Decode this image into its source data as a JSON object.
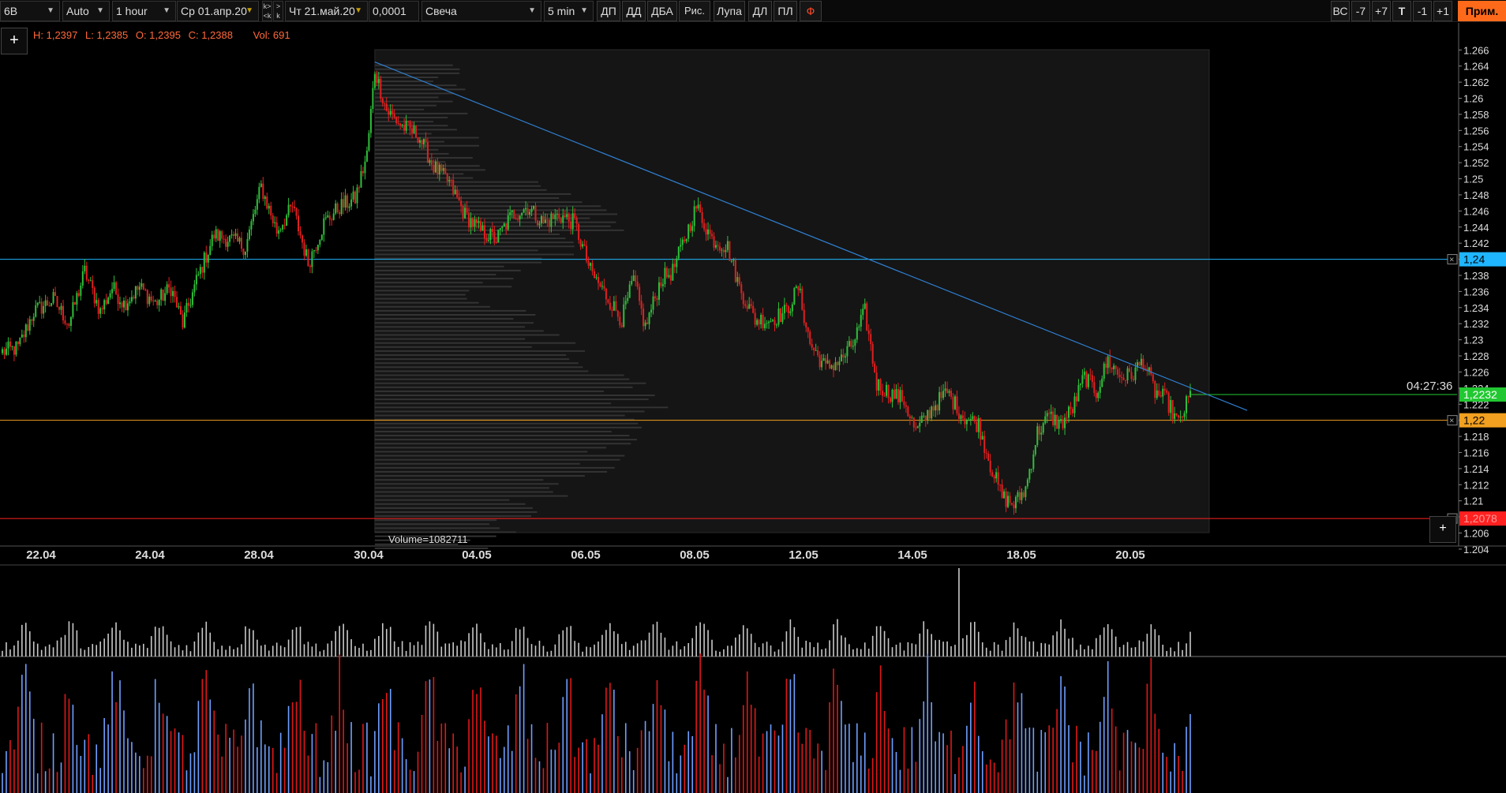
{
  "toolbar": {
    "symbol": "6B",
    "scale_mode": "Auto",
    "timeframe": "1 hour",
    "date_from": "Ср 01.апр.20",
    "date_to": "Чт 21.май.20",
    "tick_size": "0,0001",
    "chart_style": "Свеча",
    "profile_period": "5 min",
    "btn_dp": "ДП",
    "btn_dd": "ДД",
    "btn_dba": "ДБА",
    "btn_draw": "Рис.",
    "btn_zoom": "Лупа",
    "btn_dl": "ДЛ",
    "btn_pl": "ПЛ",
    "btn_phi": "Ф",
    "btn_vs": "ВС",
    "btn_minus7": "-7",
    "btn_plus7": "+7",
    "btn_t": "T",
    "btn_minus1": "-1",
    "btn_plus1": "+1",
    "btn_apply": "Прим."
  },
  "ohlc": {
    "high": "H: 1,2397",
    "low": "L: 1,2385",
    "open": "O: 1,2395",
    "close": "C: 1,2388",
    "volume": "Vol: 691"
  },
  "volume_profile_label": "Volume=1082711",
  "timer": "04:27:36",
  "price_labels": {
    "line_blue": "1,24",
    "last": "1,2232",
    "line_orange": "1,22",
    "line_red": "1,2078"
  },
  "colors": {
    "up": "#2fbf3a",
    "down": "#e02020",
    "blue_line": "#1fb6ff",
    "orange_line": "#f2a020",
    "red_line": "#ff2020",
    "trend": "#2f7fd0",
    "last_price": "#22c832",
    "vol_red": "#e01818",
    "vol_blue": "#6f9fff",
    "apply_button": "#ff6a1a"
  },
  "chart_data": {
    "type": "candlestick",
    "yticks": [
      "1.266",
      "1.264",
      "1.262",
      "1.26",
      "1.258",
      "1.256",
      "1.254",
      "1.252",
      "1.25",
      "1.248",
      "1.246",
      "1.244",
      "1.242",
      "1.24",
      "1.238",
      "1.236",
      "1.234",
      "1.232",
      "1.23",
      "1.228",
      "1.226",
      "1.224",
      "1.222",
      "1.22",
      "1.218",
      "1.216",
      "1.214",
      "1.212",
      "1.21",
      "1.208",
      "1.206",
      "1.204"
    ],
    "xticks": [
      "22.04",
      "24.04",
      "28.04",
      "30.04",
      "04.05",
      "06.05",
      "08.05",
      "12.05",
      "14.05",
      "18.05",
      "20.05"
    ],
    "ylim": [
      1.2036,
      1.2675
    ],
    "horizontal_lines": [
      {
        "price": 1.24,
        "color": "blue_line"
      },
      {
        "price": 1.22,
        "color": "orange_line"
      },
      {
        "price": 1.2078,
        "color": "red_line"
      }
    ],
    "last_price": 1.2232,
    "trendline": {
      "from": {
        "date": "30.04",
        "price": 1.2645
      },
      "to": {
        "date": "21.05",
        "price": 1.2178
      }
    },
    "waypoints": [
      {
        "i": 0,
        "p": 1.2285
      },
      {
        "i": 8,
        "p": 1.229
      },
      {
        "i": 16,
        "p": 1.2335
      },
      {
        "i": 26,
        "p": 1.235
      },
      {
        "i": 34,
        "p": 1.232
      },
      {
        "i": 42,
        "p": 1.2385
      },
      {
        "i": 50,
        "p": 1.2335
      },
      {
        "i": 56,
        "p": 1.2365
      },
      {
        "i": 62,
        "p": 1.2345
      },
      {
        "i": 70,
        "p": 1.2365
      },
      {
        "i": 78,
        "p": 1.2345
      },
      {
        "i": 86,
        "p": 1.2365
      },
      {
        "i": 92,
        "p": 1.232
      },
      {
        "i": 100,
        "p": 1.238
      },
      {
        "i": 108,
        "p": 1.243
      },
      {
        "i": 116,
        "p": 1.2425
      },
      {
        "i": 124,
        "p": 1.2415
      },
      {
        "i": 132,
        "p": 1.249
      },
      {
        "i": 140,
        "p": 1.2435
      },
      {
        "i": 148,
        "p": 1.2465
      },
      {
        "i": 156,
        "p": 1.2395
      },
      {
        "i": 164,
        "p": 1.2445
      },
      {
        "i": 172,
        "p": 1.2465
      },
      {
        "i": 180,
        "p": 1.2475
      },
      {
        "i": 186,
        "p": 1.253
      },
      {
        "i": 190,
        "p": 1.2635
      },
      {
        "i": 196,
        "p": 1.2585
      },
      {
        "i": 204,
        "p": 1.2565
      },
      {
        "i": 212,
        "p": 1.2555
      },
      {
        "i": 220,
        "p": 1.2515
      },
      {
        "i": 228,
        "p": 1.2495
      },
      {
        "i": 236,
        "p": 1.2455
      },
      {
        "i": 244,
        "p": 1.2435
      },
      {
        "i": 252,
        "p": 1.2425
      },
      {
        "i": 260,
        "p": 1.2455
      },
      {
        "i": 268,
        "p": 1.2465
      },
      {
        "i": 276,
        "p": 1.2445
      },
      {
        "i": 284,
        "p": 1.2455
      },
      {
        "i": 292,
        "p": 1.2445
      },
      {
        "i": 300,
        "p": 1.2385
      },
      {
        "i": 308,
        "p": 1.2355
      },
      {
        "i": 316,
        "p": 1.2325
      },
      {
        "i": 322,
        "p": 1.2375
      },
      {
        "i": 328,
        "p": 1.2315
      },
      {
        "i": 336,
        "p": 1.2375
      },
      {
        "i": 342,
        "p": 1.2385
      },
      {
        "i": 348,
        "p": 1.2425
      },
      {
        "i": 354,
        "p": 1.2465
      },
      {
        "i": 362,
        "p": 1.2425
      },
      {
        "i": 370,
        "p": 1.2415
      },
      {
        "i": 376,
        "p": 1.2365
      },
      {
        "i": 384,
        "p": 1.2325
      },
      {
        "i": 392,
        "p": 1.2325
      },
      {
        "i": 400,
        "p": 1.2335
      },
      {
        "i": 406,
        "p": 1.2365
      },
      {
        "i": 412,
        "p": 1.2295
      },
      {
        "i": 420,
        "p": 1.2265
      },
      {
        "i": 428,
        "p": 1.2275
      },
      {
        "i": 434,
        "p": 1.2295
      },
      {
        "i": 440,
        "p": 1.2335
      },
      {
        "i": 446,
        "p": 1.2245
      },
      {
        "i": 452,
        "p": 1.2235
      },
      {
        "i": 460,
        "p": 1.2225
      },
      {
        "i": 466,
        "p": 1.2185
      },
      {
        "i": 474,
        "p": 1.2215
      },
      {
        "i": 482,
        "p": 1.2235
      },
      {
        "i": 490,
        "p": 1.2205
      },
      {
        "i": 498,
        "p": 1.2195
      },
      {
        "i": 504,
        "p": 1.2145
      },
      {
        "i": 510,
        "p": 1.2105
      },
      {
        "i": 516,
        "p": 1.2095
      },
      {
        "i": 522,
        "p": 1.2115
      },
      {
        "i": 528,
        "p": 1.2185
      },
      {
        "i": 534,
        "p": 1.2205
      },
      {
        "i": 540,
        "p": 1.2195
      },
      {
        "i": 546,
        "p": 1.2215
      },
      {
        "i": 552,
        "p": 1.2255
      },
      {
        "i": 558,
        "p": 1.2235
      },
      {
        "i": 564,
        "p": 1.2275
      },
      {
        "i": 570,
        "p": 1.2255
      },
      {
        "i": 576,
        "p": 1.2255
      },
      {
        "i": 582,
        "p": 1.2275
      },
      {
        "i": 588,
        "p": 1.2235
      },
      {
        "i": 594,
        "p": 1.2225
      },
      {
        "i": 600,
        "p": 1.2195
      },
      {
        "i": 606,
        "p": 1.2232
      }
    ],
    "candle_count": 607,
    "top_volume_max": 72,
    "bottom_volume_max": 100
  }
}
